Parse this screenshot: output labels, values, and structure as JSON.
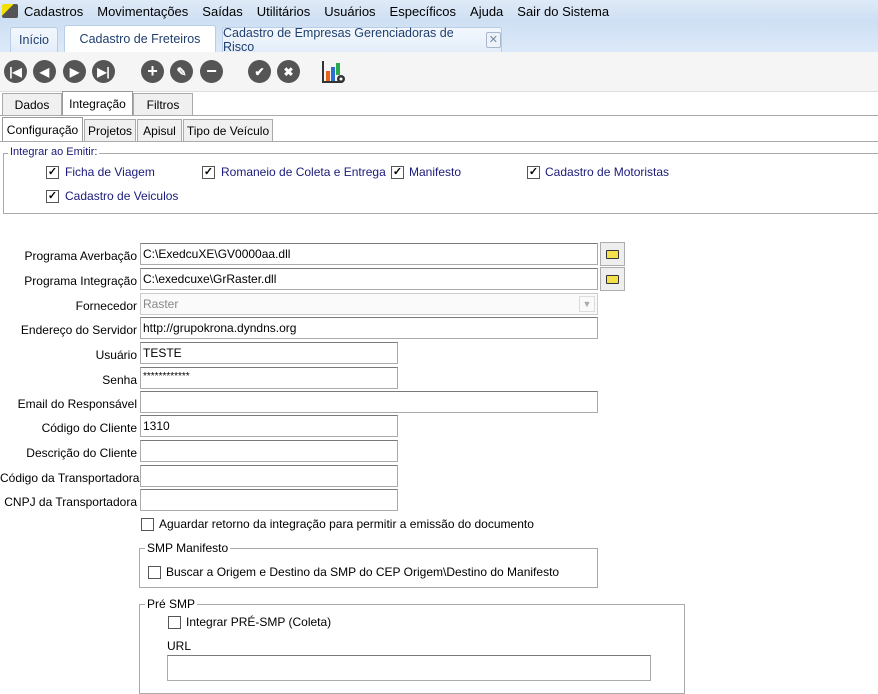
{
  "menu": [
    "Cadastros",
    "Movimentações",
    "Saídas",
    "Utilitários",
    "Usuários",
    "Específicos",
    "Ajuda",
    "Sair do Sistema"
  ],
  "doc_tabs": [
    "Início",
    "Cadastro de Freteiros",
    "Cadastro de Empresas Gerenciadoras de Risco"
  ],
  "toolbar": {
    "first": "first-icon",
    "prev": "prev-icon",
    "next": "next-icon",
    "last": "last-icon",
    "add": "plus-icon",
    "edit": "pencil-icon",
    "remove": "minus-icon",
    "confirm": "check-icon",
    "cancel": "x-icon",
    "report": "chart-gear-icon"
  },
  "tabs1": [
    "Dados",
    "Integração",
    "Filtros"
  ],
  "tabs2": [
    "Configuração",
    "Projetos",
    "Apisul",
    "Tipo de Veículo"
  ],
  "integrar": {
    "title": "Integrar ao Emitir:",
    "items": [
      {
        "label": "Ficha de Viagem",
        "checked": true
      },
      {
        "label": "Romaneio de Coleta e Entrega",
        "checked": true
      },
      {
        "label": "Manifesto",
        "checked": true
      },
      {
        "label": "Cadastro de Motoristas",
        "checked": true
      },
      {
        "label": "Cadastro de Veiculos",
        "checked": true
      }
    ]
  },
  "form": {
    "averbacao": {
      "label": "Programa Averbação",
      "value": "C:\\ExedcuXE\\GV0000aa.dll"
    },
    "integracao": {
      "label": "Programa Integração",
      "value": "C:\\exedcuxe\\GrRaster.dll"
    },
    "fornecedor": {
      "label": "Fornecedor",
      "value": "Raster"
    },
    "servidor": {
      "label": "Endereço do Servidor",
      "value": "http://grupokrona.dyndns.org"
    },
    "usuario": {
      "label": "Usuário",
      "value": "TESTE"
    },
    "senha": {
      "label": "Senha",
      "value": "************"
    },
    "email": {
      "label": "Email do Responsável",
      "value": ""
    },
    "codigo_cliente": {
      "label": "Código do Cliente",
      "value": "1310"
    },
    "descricao_cliente": {
      "label": "Descrição do Cliente",
      "value": ""
    },
    "codigo_transp": {
      "label": "Código da Transportadora",
      "value": ""
    },
    "cnpj_transp": {
      "label": "CNPJ da Transportadora",
      "value": ""
    }
  },
  "aguardar": {
    "label": "Aguardar retorno da integração para permitir a emissão do documento",
    "checked": false
  },
  "smp": {
    "title": "SMP Manifesto",
    "buscar": "Buscar a Origem e Destino da SMP do CEP Origem\\Destino do Manifesto"
  },
  "pre_smp": {
    "title": "Pré SMP",
    "integrar": "Integrar PRÉ-SMP (Coleta)",
    "url_label": "URL",
    "url_value": ""
  }
}
